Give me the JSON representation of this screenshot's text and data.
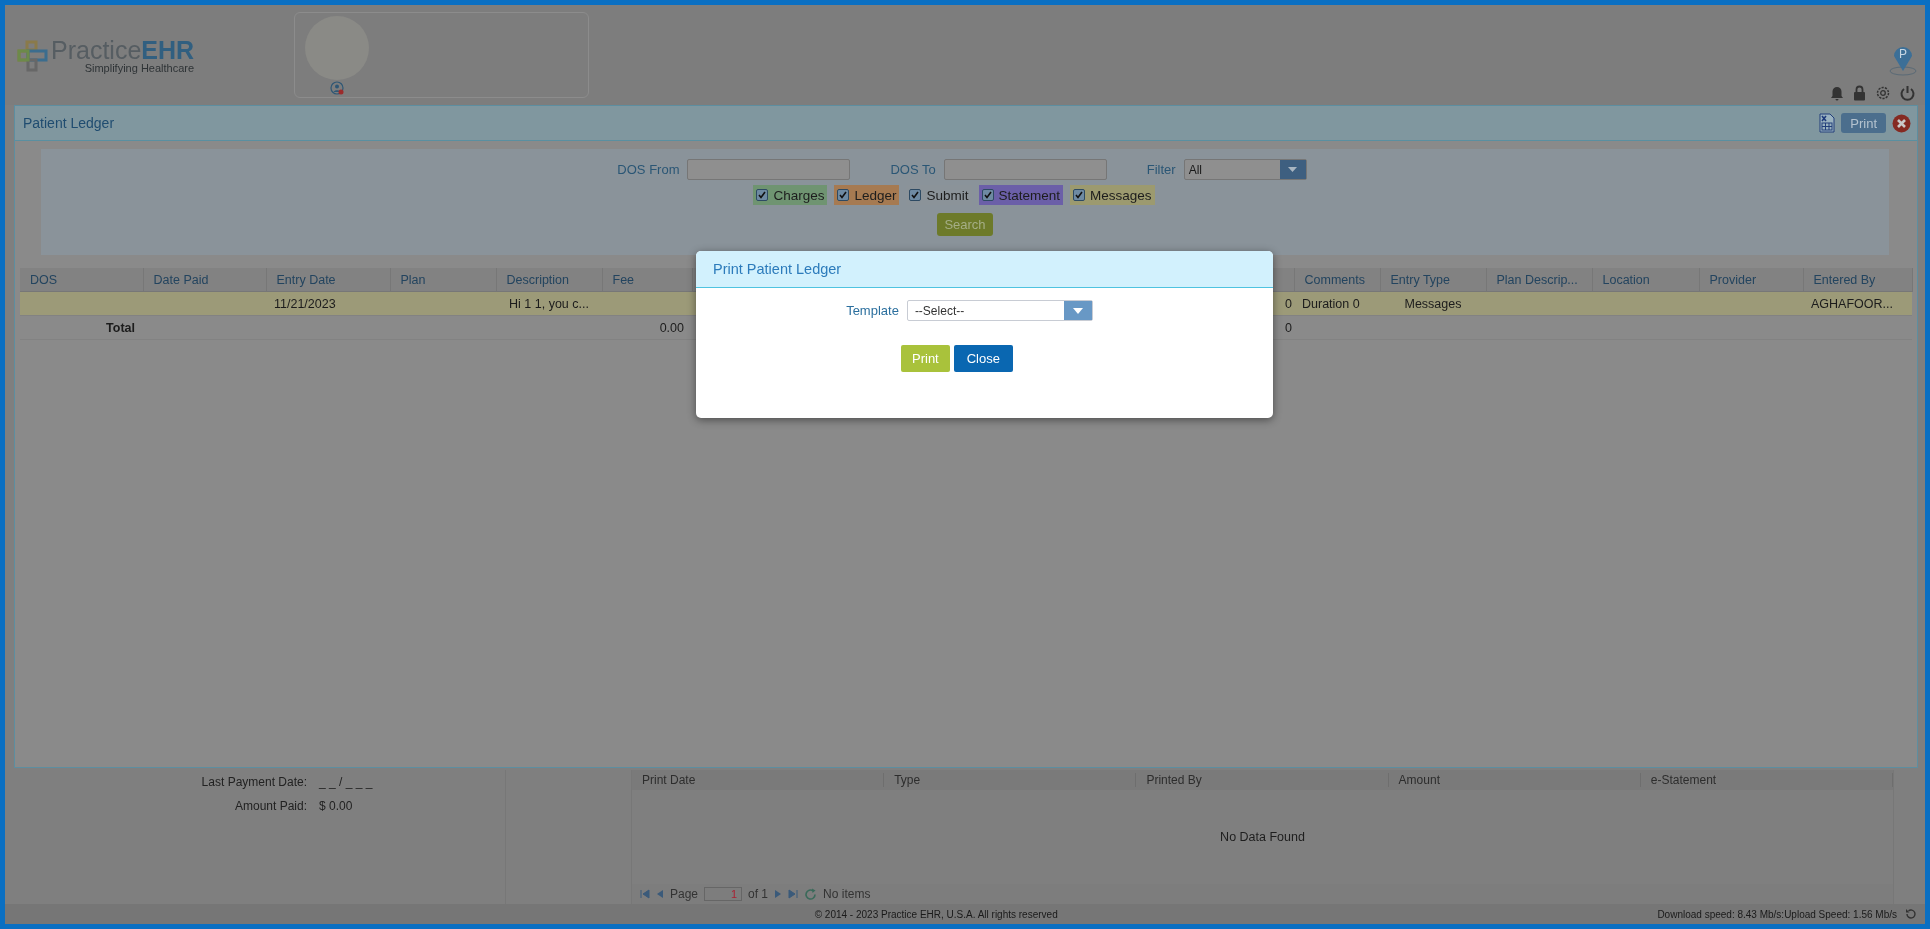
{
  "header": {
    "logo": {
      "name": "Practice",
      "accent": "EHR",
      "tagline": "Simplifying Healthcare"
    },
    "location_pin": "P"
  },
  "ledger": {
    "title": "Patient Ledger",
    "print_button": "Print",
    "fields": [
      {
        "label": "DOS From",
        "kind": "date"
      },
      {
        "label": "DOS To",
        "kind": "date"
      },
      {
        "label": "Filter",
        "kind": "select",
        "value": "All"
      }
    ],
    "categories": [
      {
        "label": "Charges",
        "checked": true,
        "color": "#6f9471"
      },
      {
        "label": "Ledger",
        "checked": true,
        "color": "#a67a51"
      },
      {
        "label": "Submit",
        "checked": true,
        "color": "#8b9399"
      },
      {
        "label": "Statement",
        "checked": true,
        "color": "#6b5fa8"
      },
      {
        "label": "Messages",
        "checked": true,
        "color": "#9c9a6f"
      }
    ],
    "search_button": "Search",
    "table": {
      "columns": [
        "DOS",
        "Date Paid",
        "Entry Date",
        "Plan",
        "Description",
        "Fee",
        "Comments",
        "Entry Type",
        "Plan Descrip...",
        "Location",
        "Provider",
        "Entered By"
      ],
      "rows": [
        {
          "kind": "entry",
          "color": "#9c9a78",
          "entry_date": "11/21/2023",
          "description": "Hi 1 1, you c...",
          "column_7": "0",
          "comments": "Duration 0",
          "entry_type": "Messages",
          "entered_by": "AGHAFOOR..."
        },
        {
          "kind": "total",
          "dos": "Total",
          "fee": "0.00",
          "column_7": "0"
        }
      ]
    }
  },
  "summary": [
    {
      "label": "Last Payment Date:",
      "value": "_ _ / _ _ _"
    },
    {
      "label": "Amount Paid:",
      "value": "$ 0.00"
    }
  ],
  "statements": {
    "columns": [
      "Print Date",
      "Type",
      "Printed By",
      "Amount",
      "e-Statement"
    ],
    "empty_message": "No Data Found",
    "pager": {
      "page_label": "Page",
      "page": "1",
      "of": "of 1",
      "items": "No items"
    }
  },
  "footer": {
    "copyright": "© 2014 - 2023 Practice EHR, U.S.A. All rights reserved",
    "speed": "Download speed: 8.43 Mb/s:Upload Speed: 1.56 Mb/s"
  },
  "dialog": {
    "title": "Print Patient Ledger",
    "template_label": "Template",
    "template_value": "--Select--",
    "buttons": [
      {
        "label": "Print",
        "kind": "primary"
      },
      {
        "label": "Close",
        "kind": "secondary"
      }
    ]
  }
}
